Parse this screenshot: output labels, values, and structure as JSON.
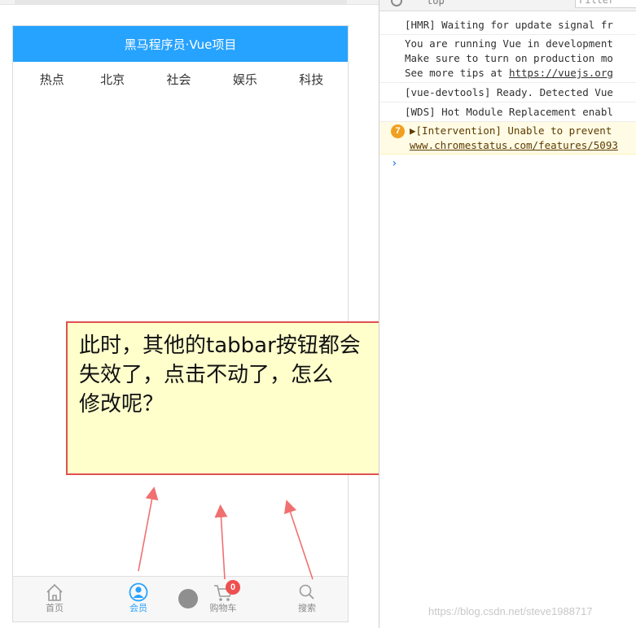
{
  "app_header": {
    "title": "黑马程序员·Vue项目"
  },
  "news_tabs": [
    {
      "label": "热点"
    },
    {
      "label": "北京"
    },
    {
      "label": "社会"
    },
    {
      "label": "娱乐"
    },
    {
      "label": "科技"
    }
  ],
  "tabbar": {
    "home": {
      "label": "首页",
      "icon": "home-icon"
    },
    "member": {
      "label": "会员",
      "icon": "user-icon",
      "active": true
    },
    "cart": {
      "label": "购物车",
      "icon": "cart-icon",
      "badge": "0"
    },
    "search": {
      "label": "搜索",
      "icon": "search-icon"
    }
  },
  "annotation": {
    "line1": "此时，其他的tabbar按钮都会",
    "line2": "失效了，点击不动了，怎么",
    "line3": "修改呢？"
  },
  "console": {
    "toolbar": {
      "context": "top",
      "filter_placeholder": "Filter"
    },
    "messages": [
      {
        "lines": [
          "[HMR] Waiting for update signal fr"
        ]
      },
      {
        "lines": [
          "You are running Vue in development",
          "Make sure to turn on production mo",
          "See more tips at "
        ],
        "link": "https://vuejs.org"
      },
      {
        "lines": [
          "[vue-devtools] Ready. Detected Vue"
        ]
      },
      {
        "lines": [
          "[WDS] Hot Module Replacement enabl"
        ]
      },
      {
        "lines": [
          "▶[Intervention] Unable to prevent"
        ],
        "link": "www.chromestatus.com/features/5093",
        "warn_count": "7"
      }
    ]
  },
  "watermark": "https://blog.csdn.net/steve1988717",
  "colors": {
    "header_blue": "#26a2ff",
    "callout_bg": "#ffffcc",
    "callout_border": "#e05050",
    "badge_red": "#ef4f4f"
  }
}
